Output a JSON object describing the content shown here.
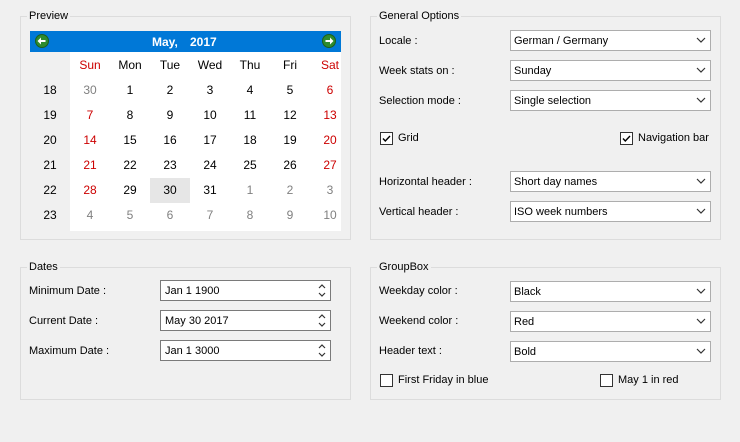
{
  "preview": {
    "title": "Preview",
    "calendar": {
      "month": "May,",
      "year": "2017",
      "weekday_headers": [
        "Sun",
        "Mon",
        "Tue",
        "Wed",
        "Thu",
        "Fri",
        "Sat"
      ],
      "week_numbers": [
        "18",
        "19",
        "20",
        "21",
        "22",
        "23"
      ],
      "weeks": [
        [
          "30",
          "1",
          "2",
          "3",
          "4",
          "5",
          "6"
        ],
        [
          "7",
          "8",
          "9",
          "10",
          "11",
          "12",
          "13"
        ],
        [
          "14",
          "15",
          "16",
          "17",
          "18",
          "19",
          "20"
        ],
        [
          "21",
          "22",
          "23",
          "24",
          "25",
          "26",
          "27"
        ],
        [
          "28",
          "29",
          "30",
          "31",
          "1",
          "2",
          "3"
        ],
        [
          "4",
          "5",
          "6",
          "7",
          "8",
          "9",
          "10"
        ]
      ],
      "selected_date": "30",
      "colors": {
        "nav_bg": "#0078d7",
        "weekend": "#c00000",
        "other_month": "#808080"
      }
    }
  },
  "general": {
    "title": "General Options",
    "locale_label": "Locale :",
    "locale_value": "German / Germany",
    "week_start_label": "Week stats on :",
    "week_start_value": "Sunday",
    "selection_label": "Selection mode :",
    "selection_value": "Single selection",
    "grid_label": "Grid",
    "grid_checked": true,
    "navbar_label": "Navigation bar",
    "navbar_checked": true,
    "hheader_label": "Horizontal header :",
    "hheader_value": "Short day names",
    "vheader_label": "Vertical header :",
    "vheader_value": "ISO week numbers"
  },
  "dates": {
    "title": "Dates",
    "min_label": "Minimum Date :",
    "min_value": "Jan 1 1900",
    "current_label": "Current Date :",
    "current_value": "May 30 2017",
    "max_label": "Maximum Date :",
    "max_value": "Jan 1 3000"
  },
  "groupbox": {
    "title": "GroupBox",
    "weekday_label": "Weekday color :",
    "weekday_value": "Black",
    "weekend_label": "Weekend color :",
    "weekend_value": "Red",
    "header_label": "Header text :",
    "header_value": "Bold",
    "first_friday_label": "First Friday in blue",
    "first_friday_checked": false,
    "may1_label": "May 1 in red",
    "may1_checked": false
  }
}
